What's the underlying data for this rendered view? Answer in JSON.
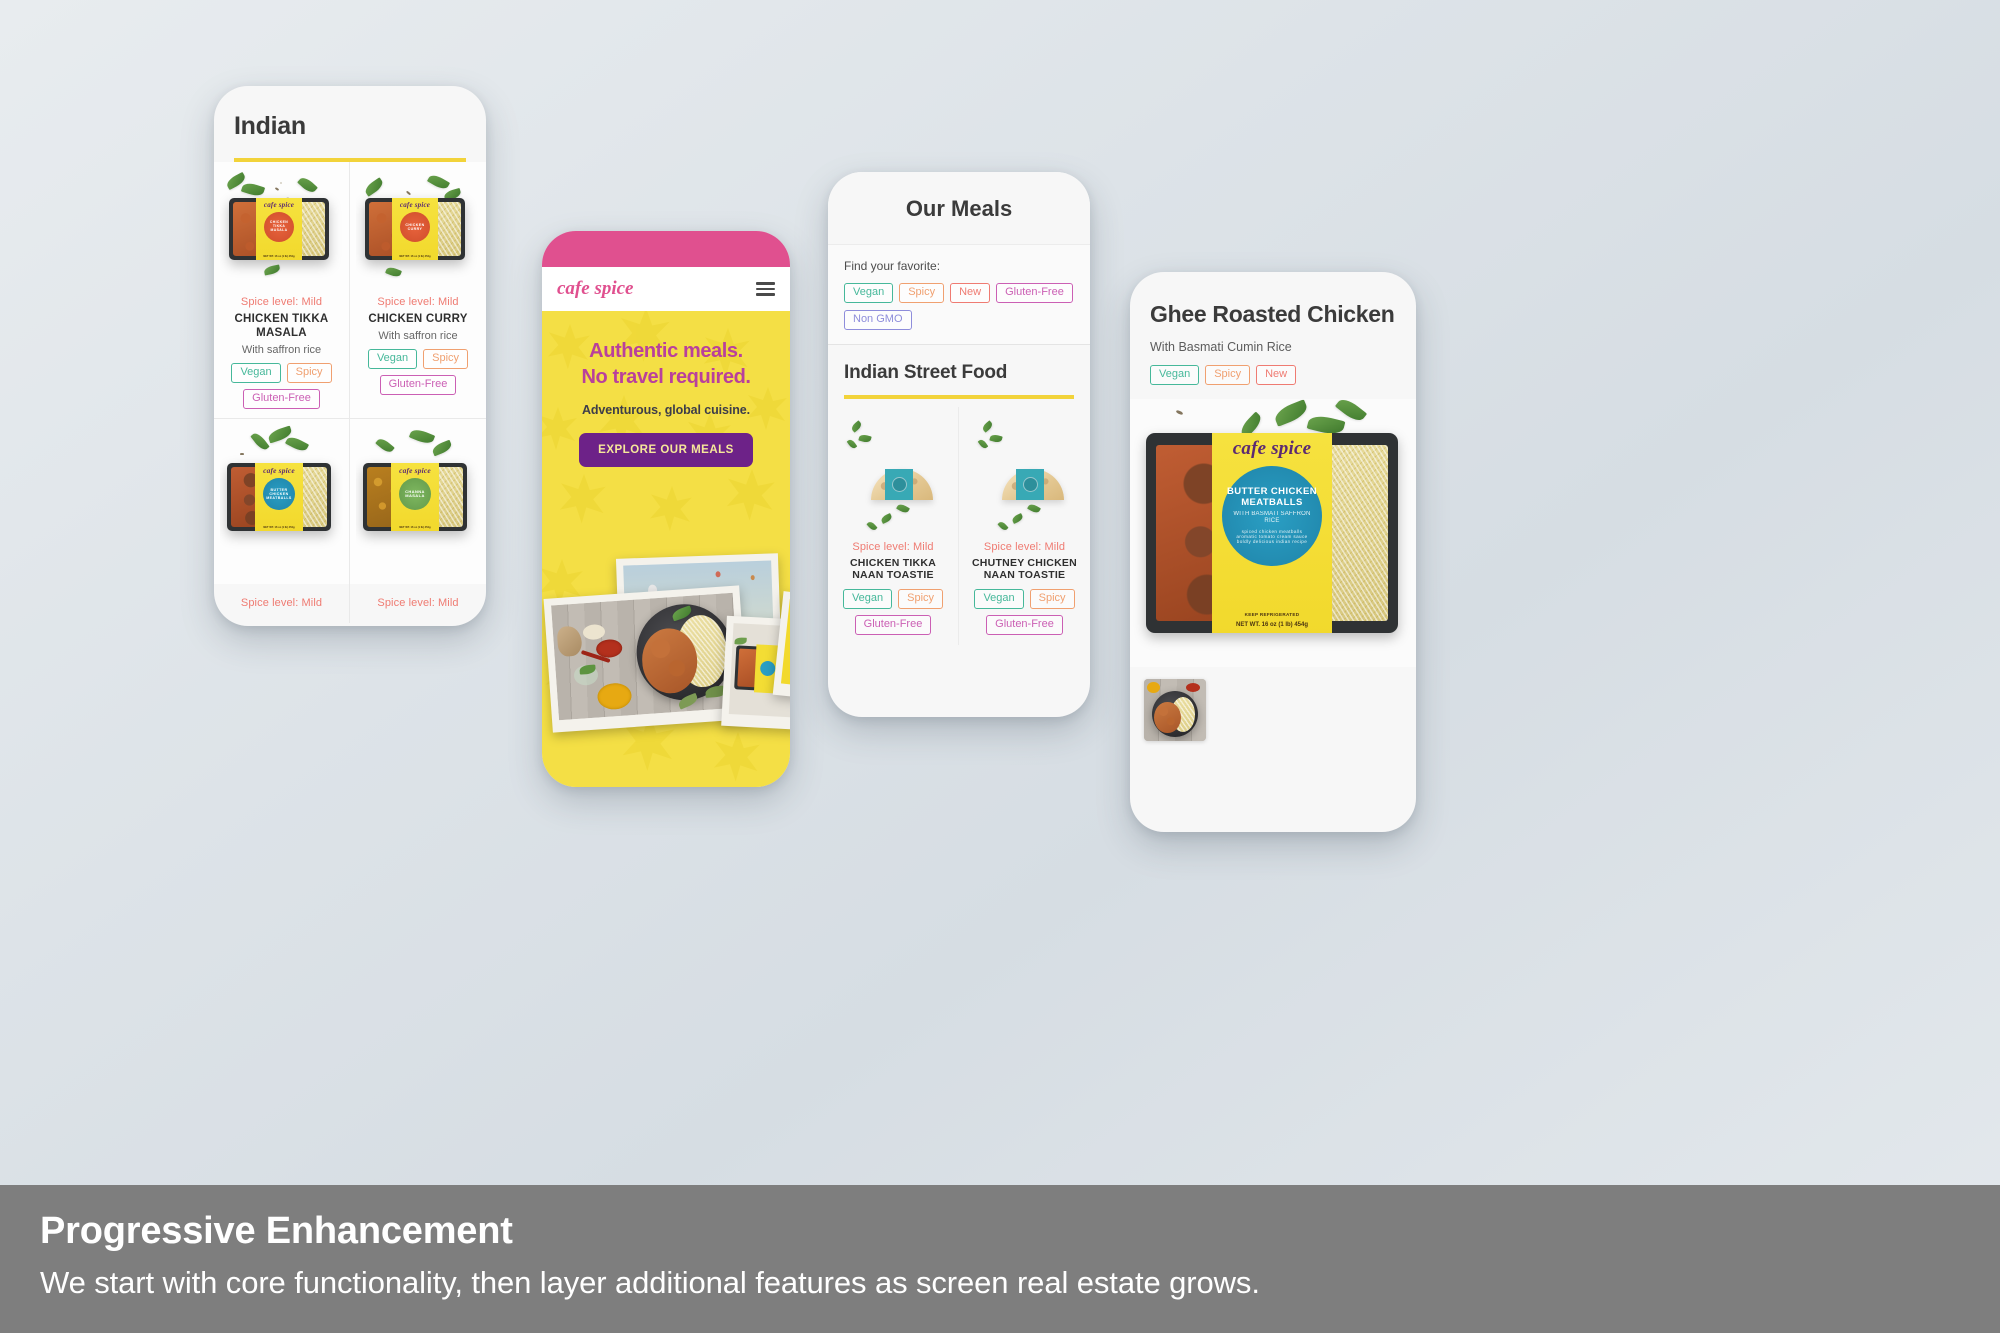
{
  "brand": {
    "name": "cafe spice"
  },
  "colors": {
    "pink": "#e0508f",
    "yellow": "#f4df45",
    "purple": "#6d2288",
    "magenta": "#b9409c",
    "accent_rule": "#f2d33a",
    "caption_bar": "#7e7e7e",
    "tag_vegan": "#46b89a",
    "tag_spicy": "#f0a070",
    "tag_new": "#ef7b72",
    "tag_gluten_free": "#cb5fb4",
    "tag_non_gmo": "#8e8ddb"
  },
  "phone1": {
    "title": "Indian",
    "products": [
      {
        "spice": "Spice level: Mild",
        "name": "CHICKEN TIKKA MASALA",
        "desc": "With saffron rice",
        "tags": [
          "Vegan",
          "Spicy",
          "Gluten-Free"
        ],
        "pack_title": "CHICKEN TIKKA MASALA",
        "pack_seal": "orange"
      },
      {
        "spice": "Spice level: Mild",
        "name": "CHICKEN CURRY",
        "desc": "With saffron rice",
        "tags": [
          "Vegan",
          "Spicy",
          "Gluten-Free"
        ],
        "pack_title": "CHICKEN CURRY",
        "pack_seal": "orange"
      },
      {
        "spice": "Spice level: Mild",
        "name": "BUTTER CHICKEN MEATBALLS",
        "desc": "",
        "tags": [],
        "pack_title": "BUTTER CHICKEN MEATBALLS",
        "pack_seal": "blue"
      },
      {
        "spice": "Spice level: Mild",
        "name": "CHANNA MASALA",
        "desc": "",
        "tags": [],
        "pack_title": "CHANNA MASALA",
        "pack_seal": "green"
      }
    ]
  },
  "phone2": {
    "logo": "cafe spice",
    "menu_icon": "hamburger-menu-icon",
    "headline_line1": "Authentic meals.",
    "headline_line2": "No travel required.",
    "subheadline": "Adventurous, global cuisine.",
    "cta": "EXPLORE OUR MEALS"
  },
  "phone3": {
    "title": "Our Meals",
    "filter_label": "Find your favorite:",
    "filters": [
      "Vegan",
      "Spicy",
      "New",
      "Gluten-Free",
      "Non GMO"
    ],
    "section_title": "Indian Street Food",
    "products": [
      {
        "spice": "Spice level: Mild",
        "name": "CHICKEN TIKKA NAAN TOASTIE",
        "tags": [
          "Vegan",
          "Spicy",
          "Gluten-Free"
        ]
      },
      {
        "spice": "Spice level: Mild",
        "name": "CHUTNEY CHICKEN NAAN TOASTIE",
        "tags": [
          "Vegan",
          "Spicy",
          "Gluten-Free"
        ]
      }
    ]
  },
  "phone4": {
    "title": "Ghee Roasted Chicken",
    "subtitle": "With Basmati Cumin Rice",
    "tags": [
      "Vegan",
      "Spicy",
      "New"
    ],
    "pack": {
      "brand": "cafe spice",
      "title_line1": "BUTTER CHICKEN",
      "title_line2": "MEATBALLS",
      "subtitle": "WITH BASMATI SAFFRON RICE",
      "desc_line1": "spiced chicken meatballs",
      "desc_line2": "aromatic tomato cream sauce",
      "desc_line3": "boldly delicious indian recipe",
      "keep_refrigerated": "KEEP REFRIGERATED",
      "net_weight": "NET WT. 16 oz (1 lb) 454g"
    }
  },
  "caption": {
    "title": "Progressive Enhancement",
    "body": "We start with core functionality, then  layer additional features as screen real estate grows."
  }
}
